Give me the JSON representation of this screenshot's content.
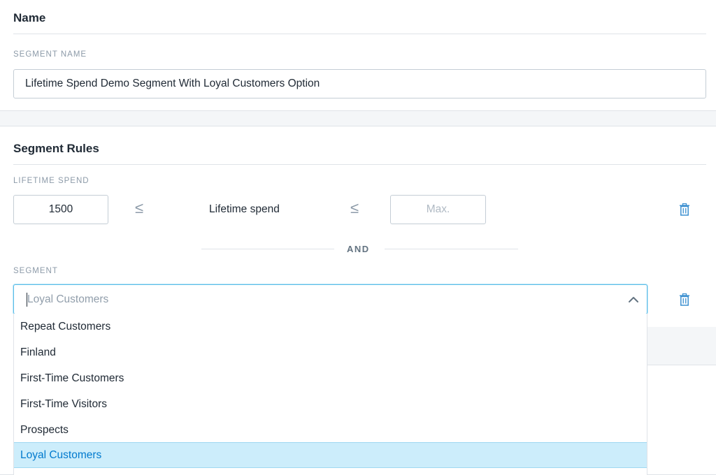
{
  "name_section": {
    "title": "Name",
    "field_label": "SEGMENT NAME",
    "value": "Lifetime Spend Demo Segment With Loyal Customers Option"
  },
  "rules_section": {
    "title": "Segment Rules",
    "lifetime_spend": {
      "label": "LIFETIME SPEND",
      "min_value": "1500",
      "operator": "≤",
      "field": "Lifetime spend",
      "max_placeholder": "Max."
    },
    "conjunction": "AND",
    "segment": {
      "label": "SEGMENT",
      "input_value": "Loyal Customers",
      "options": [
        "Repeat Customers",
        "Finland",
        "First-Time Customers",
        "First-Time Visitors",
        "Prospects",
        "Loyal Customers"
      ],
      "selected_index": 5
    }
  },
  "colors": {
    "accent": "#007ace",
    "focus_border": "#5bbde8",
    "selected_bg": "#ccedfb",
    "trash_icon": "#3b8fd0"
  },
  "icons": {
    "delete": "trash-icon",
    "collapse": "chevron-up-icon"
  }
}
